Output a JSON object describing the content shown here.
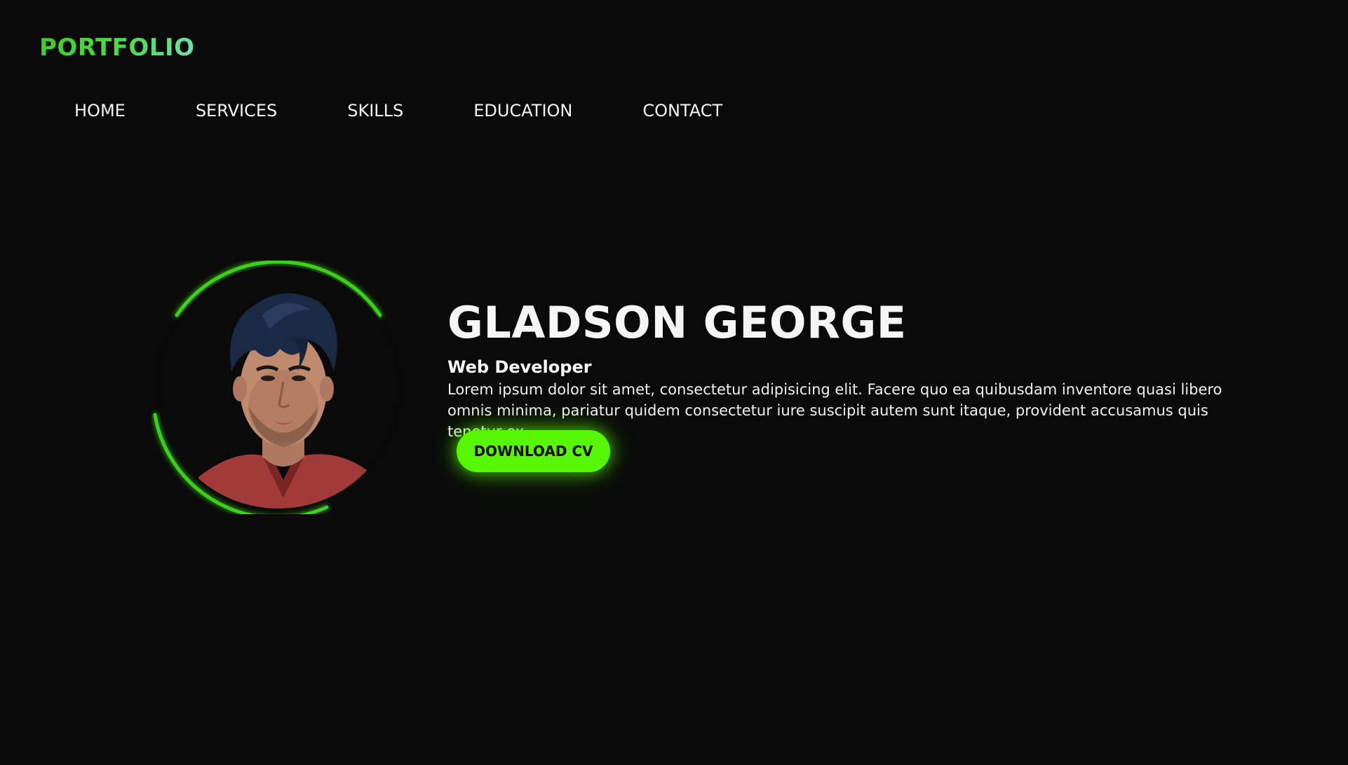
{
  "brand": {
    "logo_text": "PORTFOLIO"
  },
  "nav": {
    "items": [
      {
        "label": "HOME"
      },
      {
        "label": "SERVICES"
      },
      {
        "label": "SKILLS"
      },
      {
        "label": "EDUCATION"
      },
      {
        "label": "CONTACT"
      }
    ]
  },
  "hero": {
    "name": "GLADSON GEORGE",
    "role": "Web Developer",
    "description": "Lorem ipsum dolor sit amet, consectetur adipisicing elit. Facere quo ea quibusdam inventore quasi libero omnis minima, pariatur quidem consectetur iure suscipit autem sunt itaque, provident accusamus quis tenetur ex.",
    "cta_label": "DOWNLOAD CV"
  },
  "colors": {
    "background": "#0a0a0a",
    "accent": "#56f700",
    "logo": "#3ecb2f",
    "ring": "#3ecf1a",
    "text": "#ffffff"
  },
  "icons": {
    "avatar": "profile-photo"
  }
}
